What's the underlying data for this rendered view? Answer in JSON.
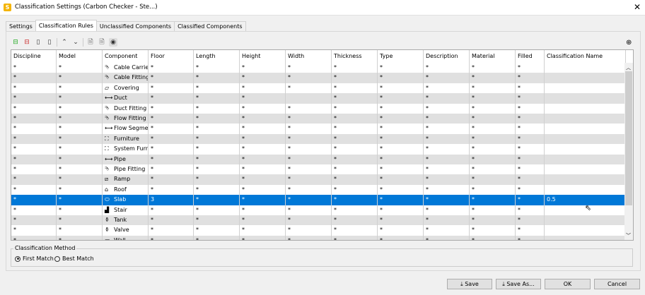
{
  "window": {
    "title": "Classification Settings (Carbon Checker - Ste...)",
    "icon_letter": "S"
  },
  "tabs": [
    {
      "label": "Settings"
    },
    {
      "label": "Classification Rules",
      "active": true
    },
    {
      "label": "Unclassified Components"
    },
    {
      "label": "Classified Components"
    }
  ],
  "toolbar": [
    "add-row-icon",
    "delete-row-icon",
    "add-column-icon",
    "delete-column-icon",
    "move-up-icon",
    "move-down-icon",
    "import-icon",
    "export-icon",
    "visibility-icon"
  ],
  "columns": [
    "Discipline",
    "Model",
    "Component",
    "Floor",
    "Length",
    "Height",
    "Width",
    "Thickness",
    "Type",
    "Description",
    "Material",
    "Filled",
    "Classification Name"
  ],
  "rows": [
    {
      "component": "Cable Carrie...",
      "icon": "cable-carrier-icon",
      "cells": [
        "*",
        "*",
        "Cable Carrie...",
        "*",
        "*",
        "*",
        "*",
        "*",
        "*",
        "*",
        "*",
        "*",
        ""
      ]
    },
    {
      "component": "Cable Fitting",
      "icon": "fitting-icon",
      "cells": [
        "*",
        "*",
        "Cable Fitting",
        "*",
        "*",
        "*",
        "*",
        "*",
        "*",
        "*",
        "*",
        "*",
        ""
      ]
    },
    {
      "component": "Covering",
      "icon": "covering-icon",
      "cells": [
        "*",
        "*",
        "Covering",
        "*",
        "*",
        "*",
        "*",
        "*",
        "*",
        "*",
        "*",
        "*",
        ""
      ]
    },
    {
      "component": "Duct",
      "icon": "segment-icon",
      "cells": [
        "*",
        "*",
        "Duct",
        "*",
        "*",
        "*",
        "",
        "*",
        "*",
        "*",
        "*",
        "*",
        ""
      ]
    },
    {
      "component": "Duct Fitting",
      "icon": "fitting-icon",
      "cells": [
        "*",
        "*",
        "Duct Fitting",
        "*",
        "*",
        "*",
        "*",
        "*",
        "*",
        "*",
        "*",
        "*",
        ""
      ]
    },
    {
      "component": "Flow Fitting",
      "icon": "fitting-icon",
      "cells": [
        "*",
        "*",
        "Flow Fitting",
        "*",
        "*",
        "*",
        "*",
        "*",
        "*",
        "*",
        "*",
        "*",
        ""
      ]
    },
    {
      "component": "Flow Segment",
      "icon": "segment-icon",
      "cells": [
        "*",
        "*",
        "Flow Segment",
        "*",
        "*",
        "*",
        "*",
        "*",
        "*",
        "*",
        "*",
        "*",
        ""
      ]
    },
    {
      "component": "Furniture",
      "icon": "furniture-icon",
      "cells": [
        "*",
        "*",
        "Furniture",
        "*",
        "*",
        "*",
        "*",
        "*",
        "*",
        "*",
        "*",
        "*",
        ""
      ]
    },
    {
      "component": "System Furn...",
      "icon": "furniture-icon",
      "cells": [
        "*",
        "*",
        "System Furn...",
        "*",
        "*",
        "*",
        "*",
        "*",
        "*",
        "*",
        "*",
        "*",
        ""
      ]
    },
    {
      "component": "Pipe",
      "icon": "segment-icon",
      "cells": [
        "*",
        "*",
        "Pipe",
        "*",
        "*",
        "*",
        "*",
        "*",
        "*",
        "*",
        "*",
        "*",
        ""
      ]
    },
    {
      "component": "Pipe Fitting",
      "icon": "fitting-icon",
      "cells": [
        "*",
        "*",
        "Pipe Fitting",
        "*",
        "*",
        "*",
        "*",
        "*",
        "*",
        "*",
        "*",
        "*",
        ""
      ]
    },
    {
      "component": "Ramp",
      "icon": "ramp-icon",
      "cells": [
        "*",
        "*",
        "Ramp",
        "*",
        "*",
        "*",
        "*",
        "*",
        "*",
        "*",
        "*",
        "*",
        ""
      ]
    },
    {
      "component": "Roof",
      "icon": "roof-icon",
      "cells": [
        "*",
        "*",
        "Roof",
        "*",
        "*",
        "*",
        "*",
        "*",
        "*",
        "*",
        "*",
        "*",
        ""
      ]
    },
    {
      "component": "Slab",
      "icon": "slab-icon",
      "selected": true,
      "cells": [
        "*",
        "*",
        "Slab",
        "3",
        "*",
        "*",
        "*",
        "*",
        "*",
        "*",
        "*",
        "*",
        "0.5"
      ]
    },
    {
      "component": "Stair",
      "icon": "stair-icon",
      "cells": [
        "*",
        "*",
        "Stair",
        "*",
        "*",
        "*",
        "*",
        "*",
        "*",
        "*",
        "*",
        "*",
        ""
      ]
    },
    {
      "component": "Tank",
      "icon": "tank-icon",
      "cells": [
        "*",
        "*",
        "Tank",
        "*",
        "*",
        "*",
        "*",
        "*",
        "*",
        "*",
        "*",
        "*",
        ""
      ]
    },
    {
      "component": "Valve",
      "icon": "valve-icon",
      "cells": [
        "*",
        "*",
        "Valve",
        "*",
        "*",
        "*",
        "*",
        "*",
        "*",
        "*",
        "*",
        "*",
        ""
      ]
    },
    {
      "component": "Wall",
      "icon": "wall-icon",
      "cells": [
        "*",
        "*",
        "Wall",
        "*",
        "*",
        "*",
        "*",
        "*",
        "*",
        "*",
        "*",
        "*",
        ""
      ]
    }
  ],
  "method": {
    "label": "Classification Method",
    "options": [
      {
        "label": "First Match",
        "checked": true
      },
      {
        "label": "Best Match",
        "checked": false
      }
    ]
  },
  "buttons": {
    "save": "Save",
    "save_as": "Save As...",
    "ok": "OK",
    "cancel": "Cancel"
  },
  "colors": {
    "selection": "#0078d7",
    "alt_row": "#e0e0e0"
  }
}
